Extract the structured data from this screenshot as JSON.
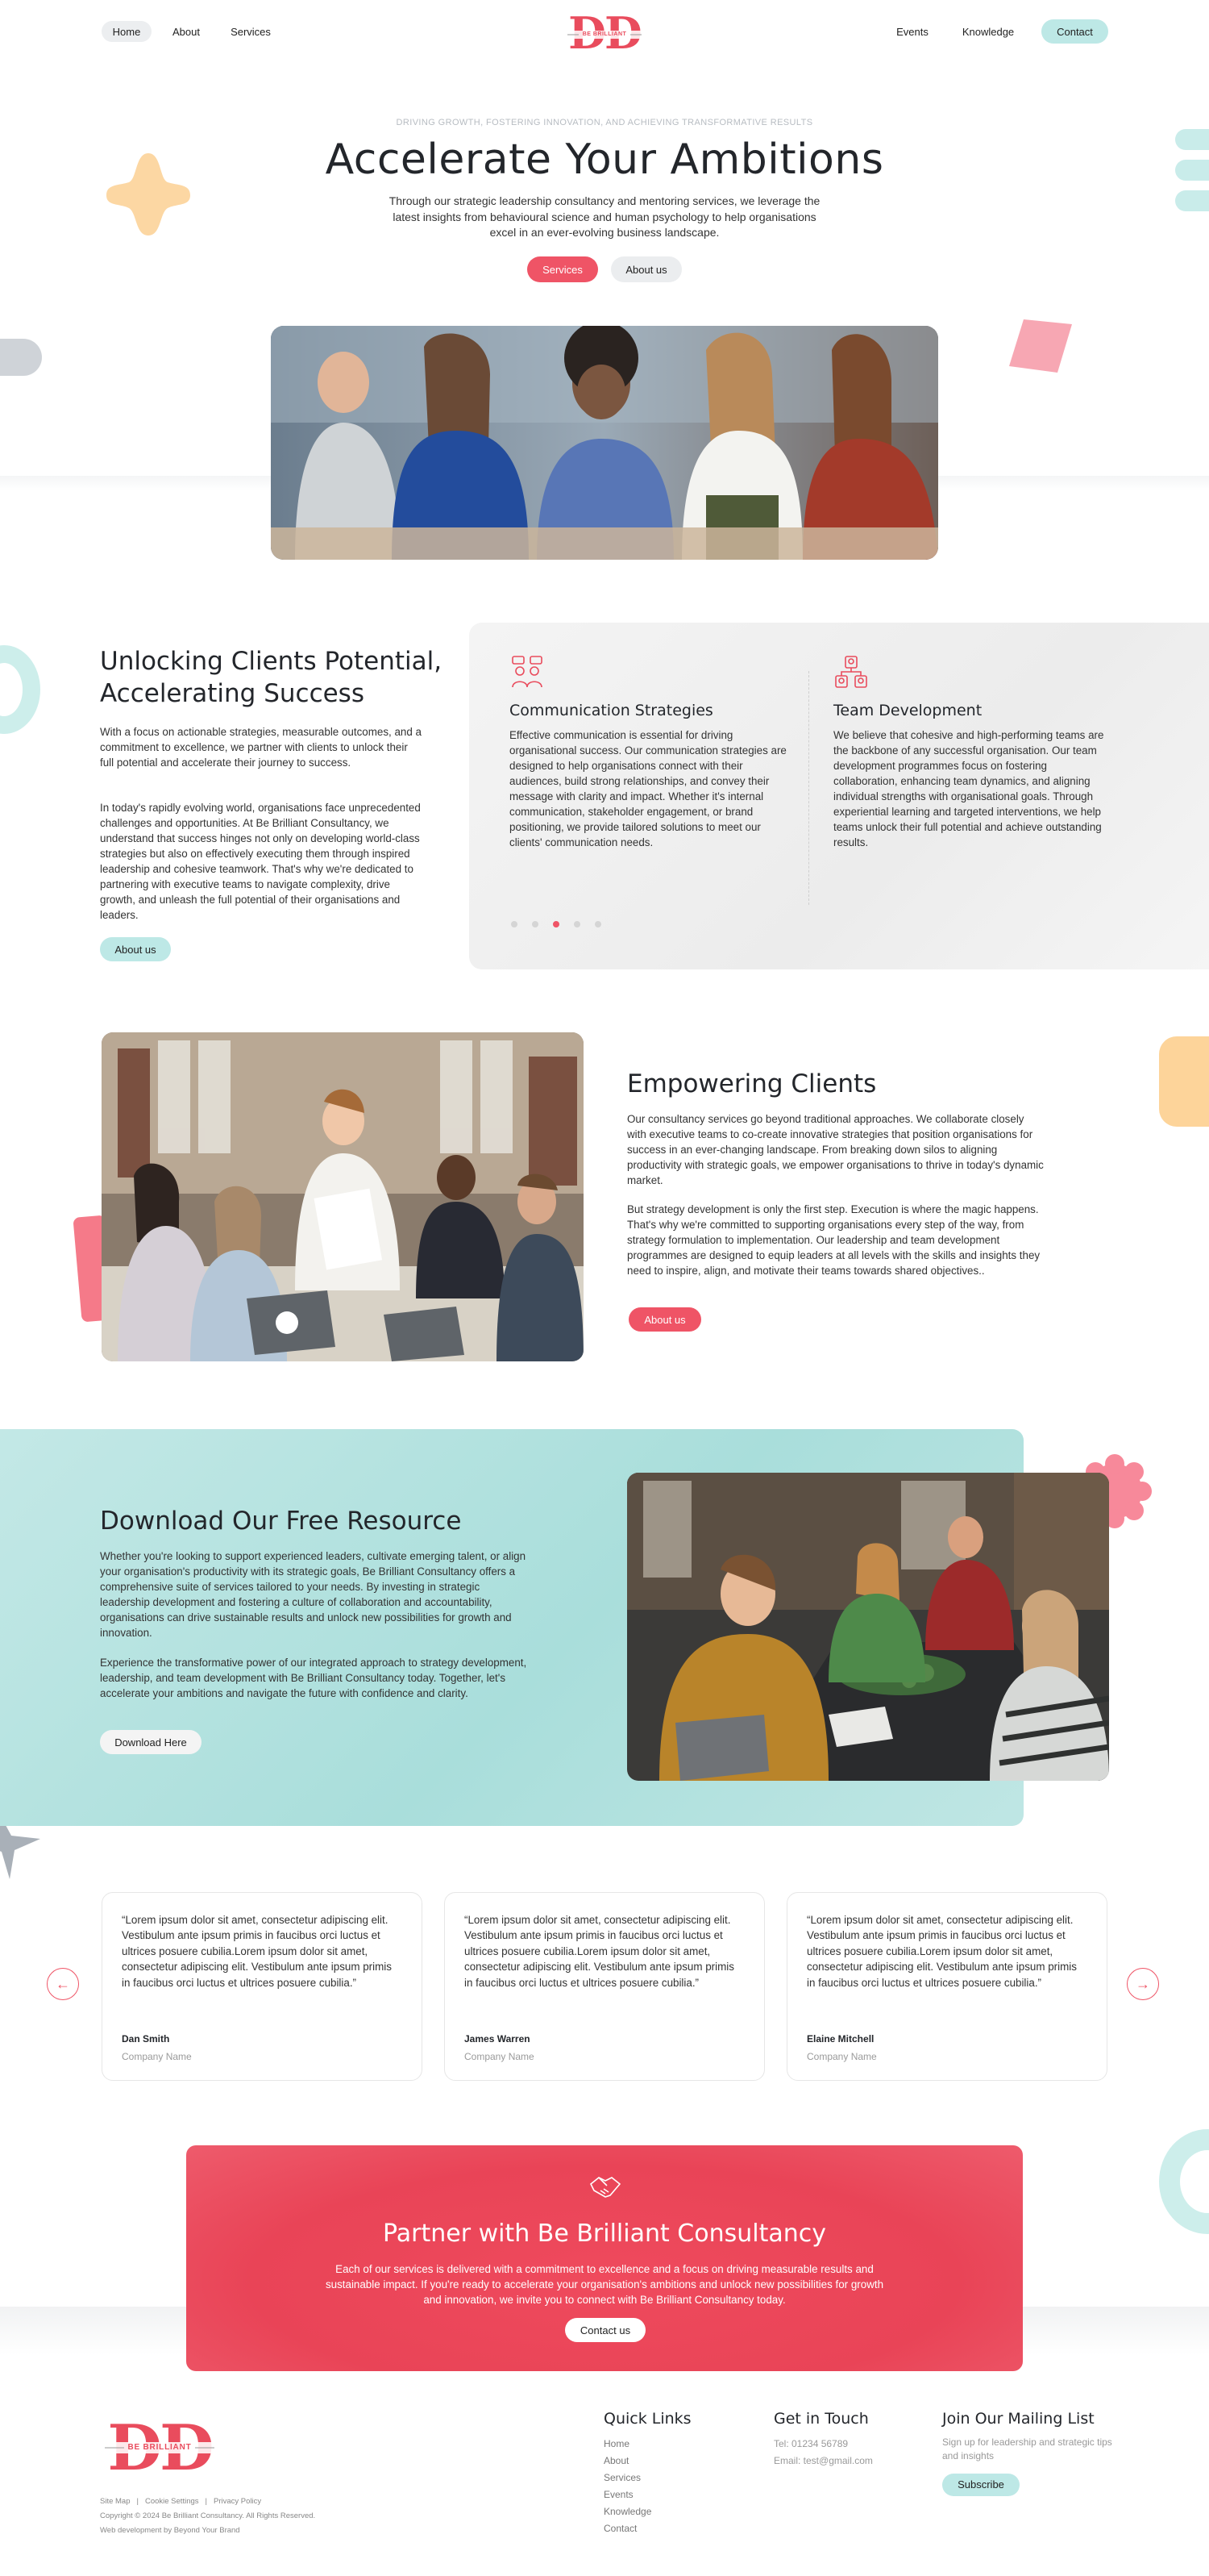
{
  "nav": {
    "left": [
      "Home",
      "About",
      "Services"
    ],
    "right": [
      "Events",
      "Knowledge"
    ],
    "contact": "Contact",
    "logo_text": "BE BRILLIANT"
  },
  "hero": {
    "tagline": "DRIVING GROWTH, FOSTERING INNOVATION, AND ACHIEVING TRANSFORMATIVE RESULTS",
    "title": "Accelerate Your Ambitions",
    "subtitle": "Through our strategic leadership consultancy and mentoring services, we leverage the latest insights from behavioural science and human psychology to help organisations excel in an ever-evolving business landscape.",
    "btn_services": "Services",
    "btn_about": "About us"
  },
  "unlock": {
    "title": "Unlocking Clients Potential, Accelerating Success",
    "p1": "With a focus on actionable strategies, measurable outcomes, and a commitment to excellence, we partner with clients to unlock their full potential and accelerate their journey to success.",
    "p2": "In today's rapidly evolving world, organisations face unprecedented challenges and opportunities. At Be Brilliant Consultancy, we understand that success hinges not only on developing world-class strategies but also on effectively executing them through inspired leadership and cohesive teamwork. That's why we're dedicated to partnering with executive teams to navigate complexity, drive growth, and unleash the full potential of their organisations and leaders.",
    "button": "About us",
    "services": [
      {
        "title": "Communication Strategies",
        "text": "Effective communication is essential for driving organisational success. Our communication strategies are designed to help organisations connect with their audiences, build strong relationships, and convey their message with clarity and impact. Whether it's internal communication, stakeholder engagement, or brand positioning, we provide tailored solutions to meet our clients' communication needs.",
        "icon": "people-chat-icon"
      },
      {
        "title": "Team Development",
        "text": "We believe that cohesive and high-performing teams are the backbone of any successful organisation. Our team development programmes focus on fostering collaboration, enhancing team dynamics, and aligning individual strengths with organisational goals. Through experiential learning and targeted interventions, we help teams unlock their full potential and achieve outstanding results.",
        "icon": "team-structure-icon"
      }
    ]
  },
  "empower": {
    "title": "Empowering Clients",
    "p1": "Our consultancy services go beyond traditional approaches. We collaborate closely with executive teams to co-create innovative strategies that position organisations for success in an ever-changing landscape. From breaking down silos to aligning productivity with strategic goals, we empower organisations to thrive in today's dynamic market.",
    "p2": "But strategy development is only the first step. Execution is where the magic happens. That's why we're committed to supporting organisations every step of the way, from strategy formulation to implementation. Our leadership and team development programmes are designed to equip leaders at all levels with the skills and insights they need to inspire, align, and motivate their teams towards shared objectives..",
    "button": "About us"
  },
  "download": {
    "title": "Download Our Free Resource",
    "p1": "Whether you're looking to support experienced leaders, cultivate emerging talent, or align your organisation's productivity with its strategic goals, Be Brilliant Consultancy offers a comprehensive suite of services tailored to your needs. By investing in strategic leadership development and fostering a culture of collaboration and accountability, organisations can drive sustainable results and unlock new possibilities for growth and innovation.",
    "p2": "Experience the transformative power of our integrated approach to strategy development, leadership, and team development with Be Brilliant Consultancy today. Together, let's accelerate your ambitions and navigate the future with confidence and clarity.",
    "button": "Download Here"
  },
  "testimonials": [
    {
      "quote": "“Lorem ipsum dolor sit amet, consectetur adipiscing elit. Vestibulum ante  ipsum primis in faucibus orci luctus et ultrices posuere cubilia.Lorem ipsum dolor sit amet, consectetur adipiscing elit. Vestibulum ante ipsum primis in faucibus orci luctus et ultrices posuere cubilia.”",
      "name": "Dan Smith",
      "company": "Company Name"
    },
    {
      "quote": "“Lorem ipsum dolor sit amet, consectetur adipiscing elit. Vestibulum ante  ipsum primis in faucibus orci luctus et ultrices posuere cubilia.Lorem ipsum dolor sit amet, consectetur adipiscing elit. Vestibulum ante ipsum primis in faucibus orci luctus et ultrices posuere cubilia.”",
      "name": "James Warren",
      "company": "Company Name"
    },
    {
      "quote": "“Lorem ipsum dolor sit amet, consectetur adipiscing elit. Vestibulum ante  ipsum primis in faucibus orci luctus et ultrices posuere cubilia.Lorem ipsum dolor sit amet, consectetur adipiscing elit. Vestibulum ante ipsum primis in faucibus orci luctus et ultrices posuere cubilia.”",
      "name": "Elaine Mitchell",
      "company": "Company Name"
    }
  ],
  "partner": {
    "title": "Partner with Be Brilliant Consultancy",
    "text": "Each of our services is delivered with a commitment to excellence and a focus on driving measurable results and sustainable impact. If you're ready to accelerate your organisation's ambitions and unlock new possibilities for growth and innovation, we invite you to connect with Be Brilliant Consultancy today.",
    "button": "Contact us"
  },
  "footer": {
    "logo_text": "BE BRILLIANT",
    "legal_links": [
      "Site Map",
      "Cookie Settings",
      "Privacy Policy"
    ],
    "copyright": "Copyright © 2024 Be Brilliant Consultancy. All Rights Reserved.",
    "credit": "Web development by Beyond Your Brand",
    "quick_links_title": "Quick Links",
    "quick_links": [
      "Home",
      "About",
      "Services",
      "Events",
      "Knowledge",
      "Contact"
    ],
    "touch_title": "Get in Touch",
    "tel": "Tel: 01234 56789",
    "email": "Email: test@gmail.com",
    "mailing_title": "Join Our Mailing List",
    "mailing_text": "Sign up for leadership and strategic tips and insights",
    "subscribe": "Subscribe"
  },
  "colors": {
    "accent": "#ef5466",
    "teal": "#bfe6e4",
    "orange": "#ffd49a",
    "pink": "#f26c7c"
  }
}
